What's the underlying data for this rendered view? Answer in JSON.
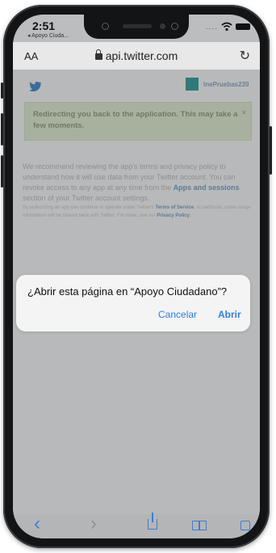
{
  "status_bar": {
    "time": "2:51",
    "back_app": "◂ Apoyo Ciuda...",
    "signal": "....",
    "wifi_icon": "wifi-icon",
    "battery_icon": "battery-icon"
  },
  "address_bar": {
    "text_size_label": "AA",
    "url": "api.twitter.com",
    "lock_icon": "lock-icon",
    "reload_icon": "reload-icon"
  },
  "page": {
    "logo_icon": "twitter-bird-icon",
    "account_name": "InePruebas239",
    "redirect_message": "Redirecting you back to the application. This may take a few moments.",
    "redirect_close": "×",
    "recommend_text_1": "We recommend reviewing the app's terms and privacy policy to understand how it will use data from your Twitter account. You can revoke access to any app at any time from the ",
    "recommend_link": "Apps and sessions",
    "recommend_text_2": " section of your Twitter account settings.",
    "fine_print_1": "By authorizing an app you continue to operate under Twitter's ",
    "fine_link_terms": "Terms of Service",
    "fine_print_2": ". In particular, some usage information will be shared back with Twitter. For more, see our ",
    "fine_link_privacy": "Privacy Policy",
    "fine_print_3": "."
  },
  "dialog": {
    "title": "¿Abrir esta página en “Apoyo Ciudadano”?",
    "cancel_label": "Cancelar",
    "open_label": "Abrir"
  },
  "toolbar": {
    "back_icon": "back-chevron-icon",
    "back_glyph": "‹",
    "forward_icon": "forward-chevron-icon",
    "forward_glyph": "›",
    "share_icon": "share-icon",
    "bookmarks_icon": "bookmarks-icon",
    "tabs_icon": "tabs-icon"
  }
}
